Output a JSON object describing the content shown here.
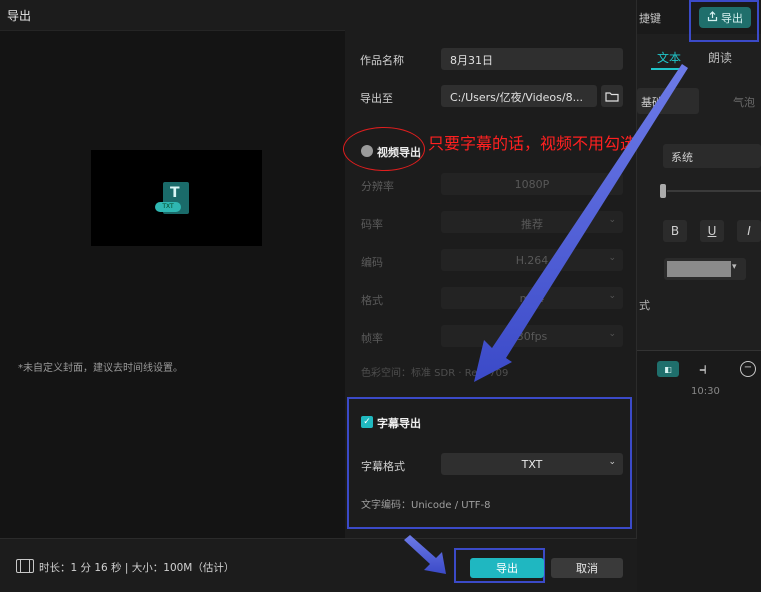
{
  "dialog": {
    "title": "导出",
    "cover_hint": "*未自定义封面，建议去时间线设置。",
    "name_label": "作品名称",
    "name_value": "8月31日",
    "path_label": "导出至",
    "path_value": "C:/Users/亿夜/Videos/8...",
    "video_export": {
      "label": "视频导出",
      "checked": false,
      "rows": [
        {
          "label": "分辨率",
          "value": "1080P"
        },
        {
          "label": "码率",
          "value": "推荐"
        },
        {
          "label": "编码",
          "value": "H.264"
        },
        {
          "label": "格式",
          "value": "mp4"
        },
        {
          "label": "帧率",
          "value": "30fps"
        }
      ],
      "color_space": "色彩空间：标准 SDR · Rec. 709"
    },
    "subtitle_export": {
      "label": "字幕导出",
      "checked": true,
      "format_label": "字幕格式",
      "format_value": "TXT",
      "encoding": "文字编码：Unicode / UTF-8"
    },
    "footer": {
      "duration_text": "时长：1 分 16 秒  |  大小：100M（估计）",
      "export_label": "导出",
      "cancel_label": "取消"
    },
    "preview_tag": "TXT",
    "annotation_note": "只要字幕的话，视频不用勾选"
  },
  "editor": {
    "shortcut_label": "捷键",
    "export_label": "导出",
    "tab_text": "文本",
    "tab_read": "朗读",
    "subtab_basic": "基础",
    "subtab_bubble": "气泡",
    "font_value": "系统",
    "bold": "B",
    "underline": "U",
    "italic": "I",
    "style_label": "式",
    "timeline_time": "10:30"
  },
  "colors": {
    "accent": "#1fb7c1",
    "annotation_red": "#ff2020",
    "annotation_blue": "#3b4ac8"
  }
}
